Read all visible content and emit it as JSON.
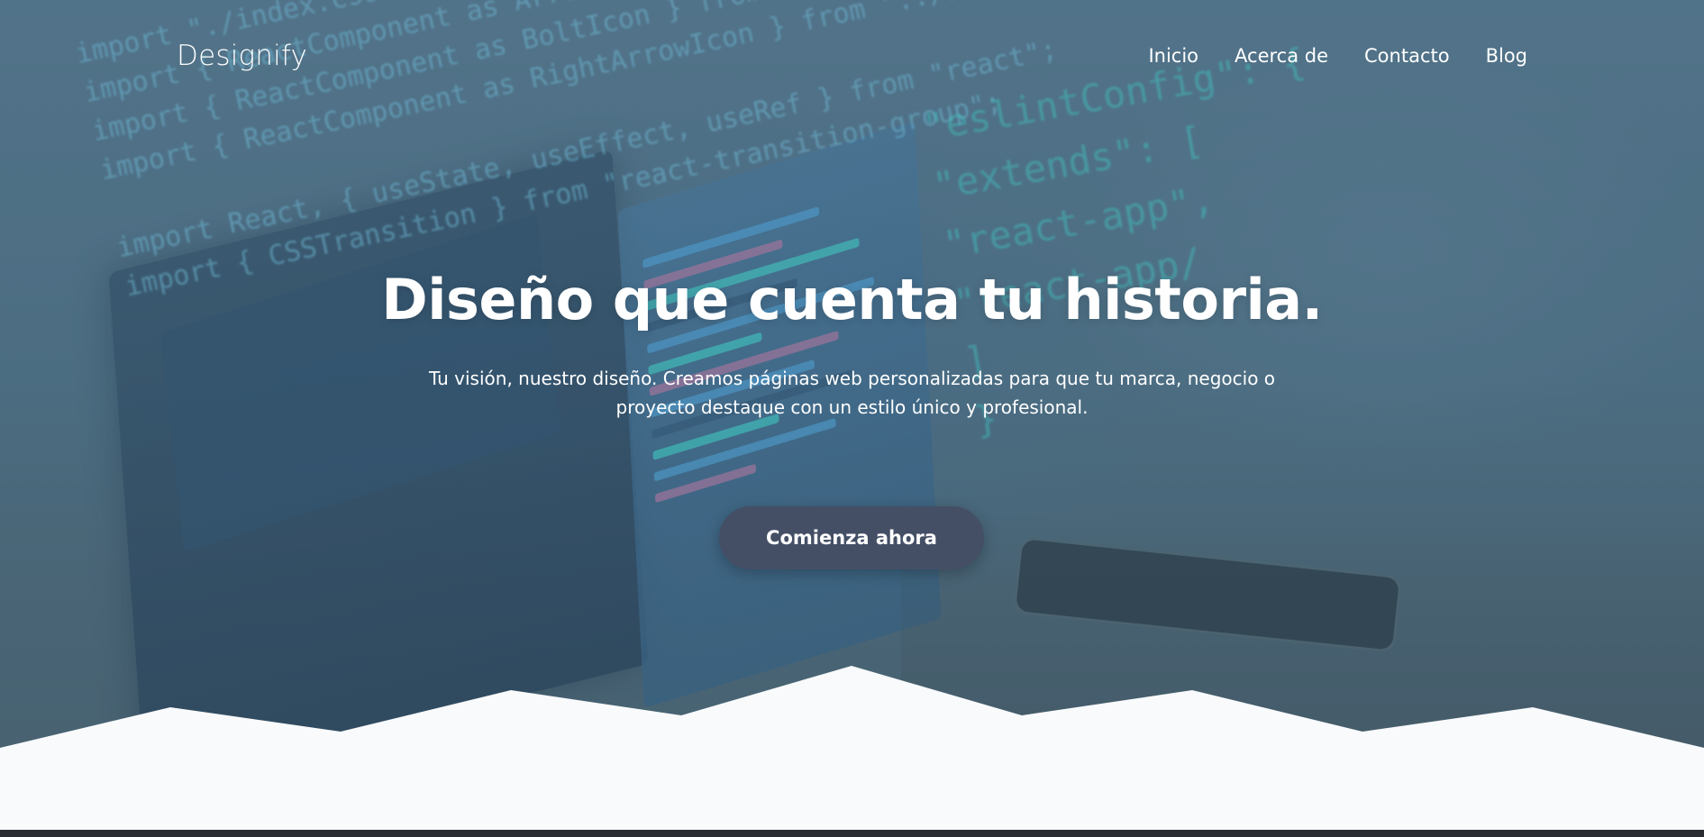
{
  "header": {
    "logo": "Designify",
    "nav": [
      {
        "label": "Inicio"
      },
      {
        "label": "Acerca de"
      },
      {
        "label": "Contacto"
      },
      {
        "label": "Blog"
      }
    ]
  },
  "hero": {
    "title": "Diseño que cuenta tu historia.",
    "subtitle_line1": "Tu visión, nuestro diseño. Creamos páginas web personalizadas para que tu marca, negocio o",
    "subtitle_line2": "proyecto destaque con un estilo único y profesional.",
    "cta_label": "Comienza ahora"
  },
  "background": {
    "code_left": [
      "import \"./index.css\";",
      "import { ReactComponent as ArrowIcon } from \"../assets/icons/arrow.svg\";",
      "import { ReactComponent as BoltIcon } from \"../assets/icons/bolt.svg\";",
      "import { ReactComponent as RightArrowIcon } from \"../assets/icons/right-arrow.svg\";",
      "",
      "import React, { useState, useEffect, useRef } from \"react\";",
      "import { CSSTransition } from \"react-transition-group\";"
    ],
    "code_right": [
      "\"eslintConfig\": {",
      "  \"extends\": [",
      "    \"react-app\",",
      "    \"react-app/",
      "  ]",
      "}"
    ]
  },
  "colors": {
    "cta_bg": "#444f66",
    "wave_fill": "#f8fafc",
    "text": "#ffffff"
  }
}
